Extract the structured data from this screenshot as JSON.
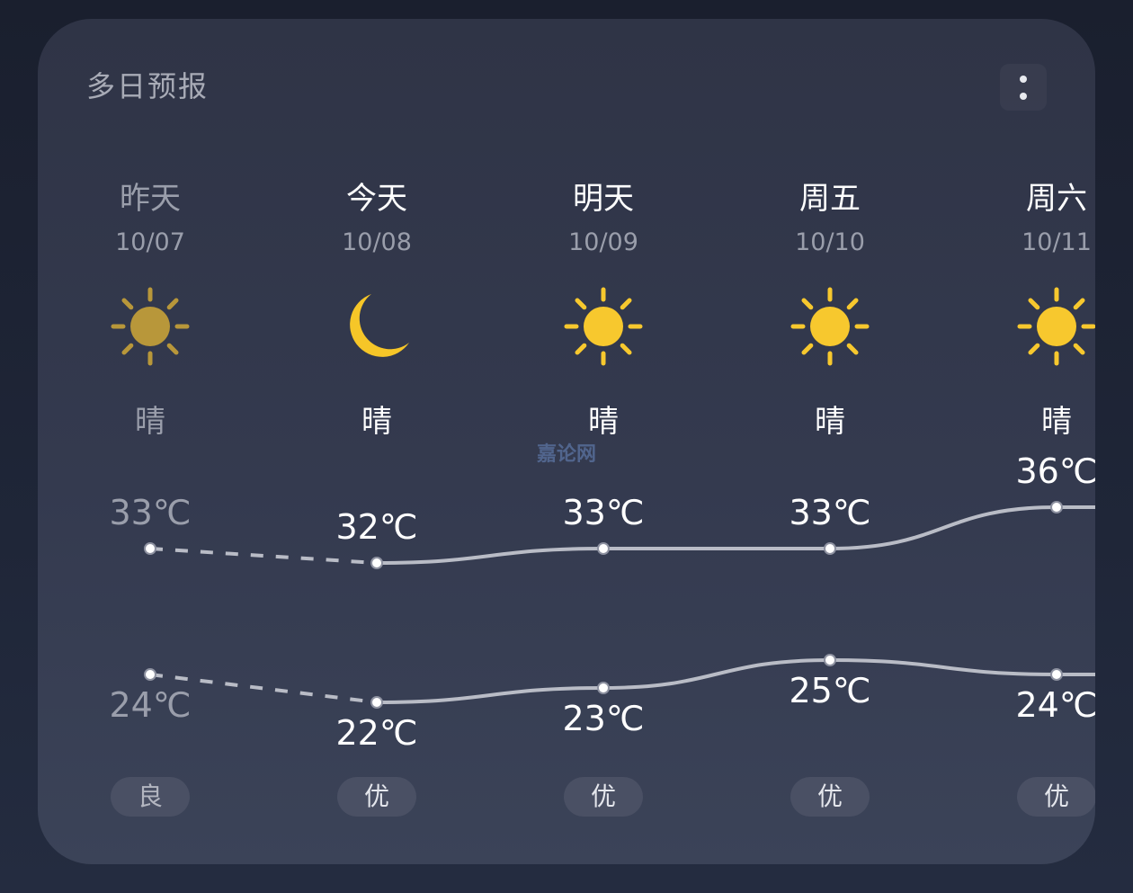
{
  "card": {
    "title": "多日预报"
  },
  "days": [
    {
      "day": "昨天",
      "date": "10/07",
      "condition": "晴",
      "icon": "sun-icon",
      "high": "33℃",
      "low": "24℃",
      "aqi": "良",
      "past": true
    },
    {
      "day": "今天",
      "date": "10/08",
      "condition": "晴",
      "icon": "moon-icon",
      "high": "32℃",
      "low": "22℃",
      "aqi": "优",
      "past": false
    },
    {
      "day": "明天",
      "date": "10/09",
      "condition": "晴",
      "icon": "sun-icon",
      "high": "33℃",
      "low": "23℃",
      "aqi": "优",
      "past": false
    },
    {
      "day": "周五",
      "date": "10/10",
      "condition": "晴",
      "icon": "sun-icon",
      "high": "33℃",
      "low": "25℃",
      "aqi": "优",
      "past": false
    },
    {
      "day": "周六",
      "date": "10/11",
      "condition": "晴",
      "icon": "sun-icon",
      "high": "36℃",
      "low": "24℃",
      "aqi": "优",
      "past": false
    }
  ],
  "watermark": "嘉论网",
  "colors": {
    "sun": "#f7c82e",
    "sun_past": "#b8973a",
    "moon": "#f6c628",
    "line": "#b9bcc6"
  }
}
